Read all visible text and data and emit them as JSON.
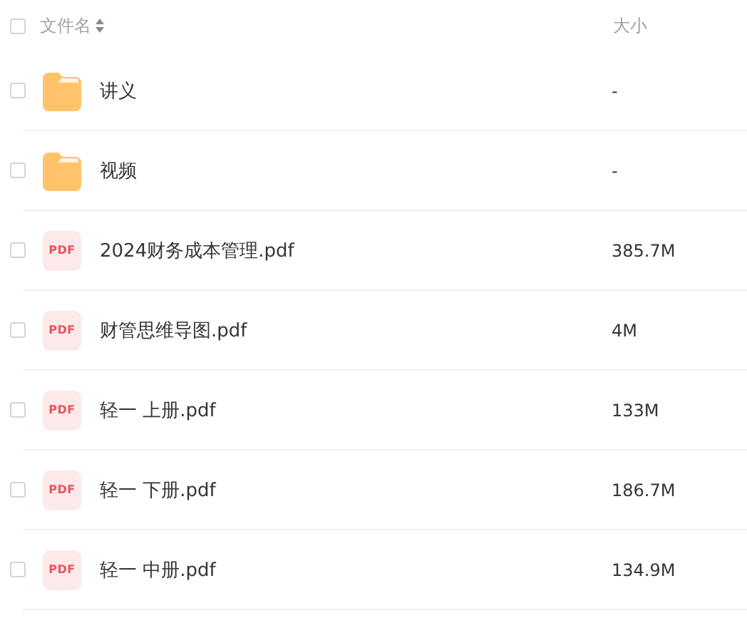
{
  "header": {
    "checked": false,
    "name_label": "文件名",
    "size_label": "大小"
  },
  "files": [
    {
      "kind": "folder",
      "name": "讲义",
      "size": "-",
      "checked": false
    },
    {
      "kind": "folder",
      "name": "视频",
      "size": "-",
      "checked": false
    },
    {
      "kind": "pdf",
      "icon_label": "PDF",
      "name": "2024财务成本管理.pdf",
      "size": "385.7M",
      "checked": false
    },
    {
      "kind": "pdf",
      "icon_label": "PDF",
      "name": "财管思维导图.pdf",
      "size": "4M",
      "checked": false
    },
    {
      "kind": "pdf",
      "icon_label": "PDF",
      "name": "轻一 上册.pdf",
      "size": "133M",
      "checked": false
    },
    {
      "kind": "pdf",
      "icon_label": "PDF",
      "name": "轻一 下册.pdf",
      "size": "186.7M",
      "checked": false
    },
    {
      "kind": "pdf",
      "icon_label": "PDF",
      "name": "轻一 中册.pdf",
      "size": "134.9M",
      "checked": false
    }
  ]
}
